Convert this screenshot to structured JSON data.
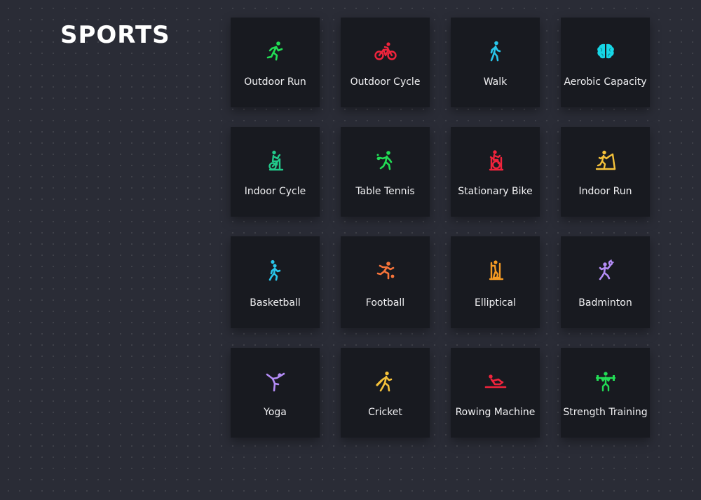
{
  "page": {
    "title": "SPORTS"
  },
  "sports": [
    {
      "label": "Outdoor Run",
      "icon": "outdoor-run-icon",
      "color": "#22dd55"
    },
    {
      "label": "Outdoor Cycle",
      "icon": "outdoor-cycle-icon",
      "color": "#f0243c"
    },
    {
      "label": "Walk",
      "icon": "walk-icon",
      "color": "#29c6ea"
    },
    {
      "label": "Aerobic Capacity",
      "icon": "brain-icon",
      "color": "#17d7e6"
    },
    {
      "label": "Indoor Cycle",
      "icon": "indoor-cycle-icon",
      "color": "#22c98a"
    },
    {
      "label": "Table Tennis",
      "icon": "table-tennis-icon",
      "color": "#22dd55"
    },
    {
      "label": "Stationary Bike",
      "icon": "stationary-bike-icon",
      "color": "#f0243c"
    },
    {
      "label": "Indoor Run",
      "icon": "treadmill-icon",
      "color": "#f5c23a"
    },
    {
      "label": "Basketball",
      "icon": "basketball-icon",
      "color": "#29c6ea"
    },
    {
      "label": "Football",
      "icon": "football-icon",
      "color": "#f7743a"
    },
    {
      "label": "Elliptical",
      "icon": "elliptical-icon",
      "color": "#f59a23"
    },
    {
      "label": "Badminton",
      "icon": "badminton-icon",
      "color": "#b38cf5"
    },
    {
      "label": "Yoga",
      "icon": "yoga-icon",
      "color": "#b38cf5"
    },
    {
      "label": "Cricket",
      "icon": "cricket-icon",
      "color": "#f5c23a"
    },
    {
      "label": "Rowing Machine",
      "icon": "rowing-machine-icon",
      "color": "#f0243c"
    },
    {
      "label": "Strength Training",
      "icon": "strength-training-icon",
      "color": "#22dd55"
    }
  ]
}
